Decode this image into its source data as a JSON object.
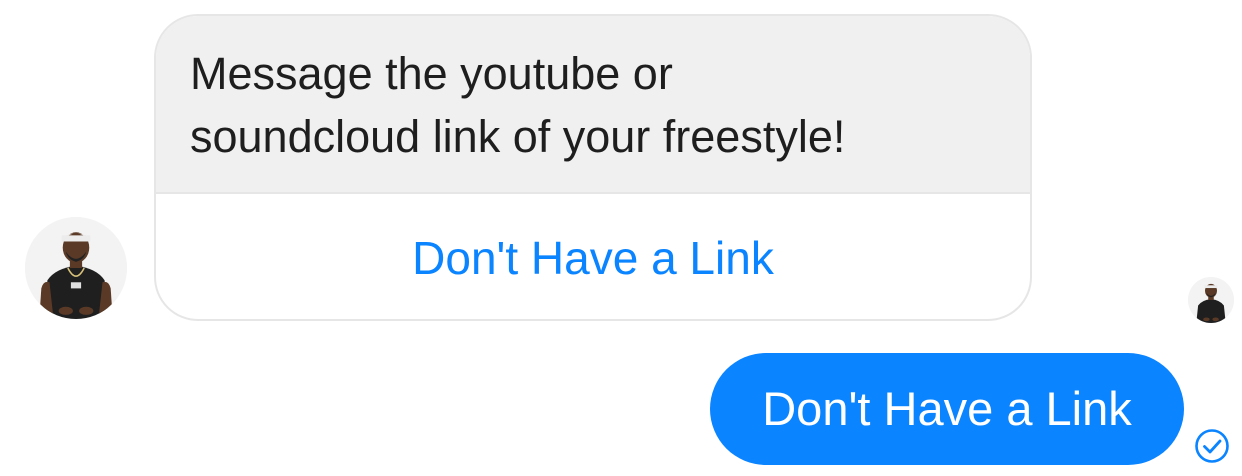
{
  "conversation": {
    "bot_message": {
      "text_line1": "Message the youtube or",
      "text_line2": "soundcloud link of your freestyle!",
      "quick_reply_label": "Don't Have a Link"
    },
    "user_message": {
      "text": "Don't Have a Link"
    },
    "icons": {
      "bot_avatar": "avatar-photo",
      "read_receipt_avatar": "avatar-photo-small",
      "delivered": "check-circle-icon"
    },
    "colors": {
      "accent": "#0a84ff",
      "bubble_gray": "#f0f0f0",
      "text_dark": "#1e1e1e"
    }
  }
}
